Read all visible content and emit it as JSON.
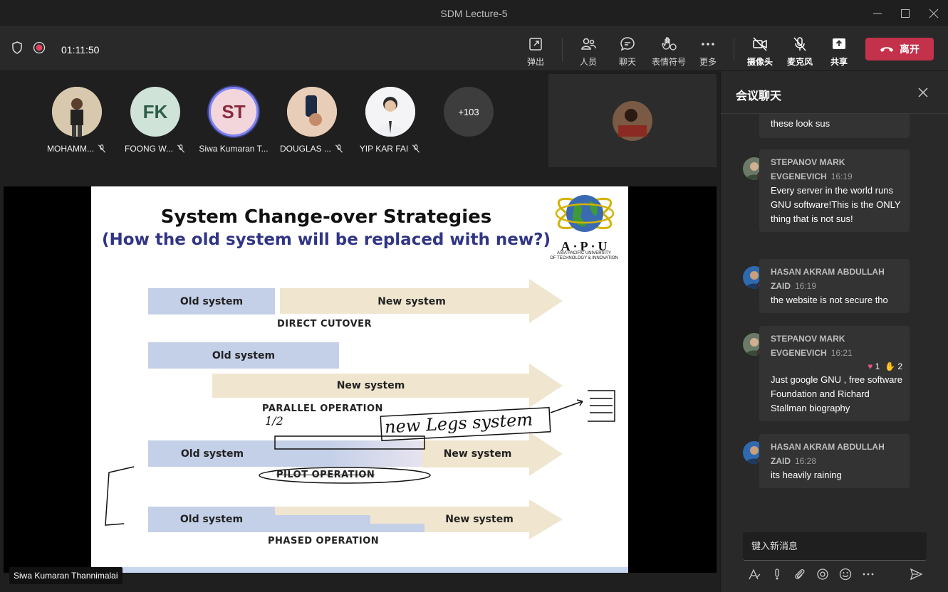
{
  "window": {
    "title": "SDM Lecture-5"
  },
  "toolbar": {
    "timer": "01:11:50",
    "buttons": {
      "popout": "弹出",
      "people": "人员",
      "chat": "聊天",
      "reactions": "表情符号",
      "more": "更多",
      "camera": "摄像头",
      "mic": "麦克风",
      "share": "共享"
    },
    "leave": "离开"
  },
  "participants": [
    {
      "name": "MOHAMM...",
      "initials": "",
      "avatar_color": "#8a7a60"
    },
    {
      "name": "FOONG W...",
      "initials": "FK",
      "avatar_color": "#cfe3d8"
    },
    {
      "name": "Siwa Kumaran T...",
      "initials": "ST",
      "avatar_color": "#f2d6dc"
    },
    {
      "name": "DOUGLAS ...",
      "initials": "",
      "avatar_color": "#d9b8a0"
    },
    {
      "name": "YIP KAR FAI",
      "initials": "",
      "avatar_color": "#e6e6ea"
    }
  ],
  "overflow_count": "+103",
  "slide": {
    "title": "System Change-over Strategies",
    "subtitle": "(How the old system will be replaced with new?)",
    "logo_letters": "A·P·U",
    "logo_caption_1": "ASIA PACIFIC UNIVERSITY",
    "logo_caption_2": "OF TECHNOLOGY & INNOVATION",
    "old_label": "Old system",
    "new_label": "New system",
    "methods": [
      "DIRECT CUTOVER",
      "PARALLEL OPERATION",
      "PILOT OPERATION",
      "PHASED OPERATION"
    ],
    "annotations": [
      "1/2",
      "new Legs system"
    ]
  },
  "presenter": "Siwa Kumaran Thannimalai",
  "chat": {
    "title": "会议聊天",
    "messages": [
      {
        "author": "",
        "time": "",
        "text": "these look sus"
      },
      {
        "author": "STEPANOV MARK EVGENEVICH",
        "time": "16:19",
        "text": "Every server in the world runs GNU software!This is the ONLY thing that is not sus!"
      },
      {
        "author": "HASAN AKRAM ABDULLAH ZAID",
        "time": "16:19",
        "text": "the website is not secure tho"
      },
      {
        "author": "STEPANOV MARK EVGENEVICH",
        "time": "16:21",
        "text": "Just google GNU , free software Foundation and Richard Stallman biography",
        "reactions": {
          "heart": "1",
          "thumbs": "2"
        }
      },
      {
        "author": "HASAN AKRAM ABDULLAH ZAID",
        "time": "16:28",
        "text": "its heavily raining"
      }
    ],
    "compose_placeholder": "键入新消息"
  }
}
